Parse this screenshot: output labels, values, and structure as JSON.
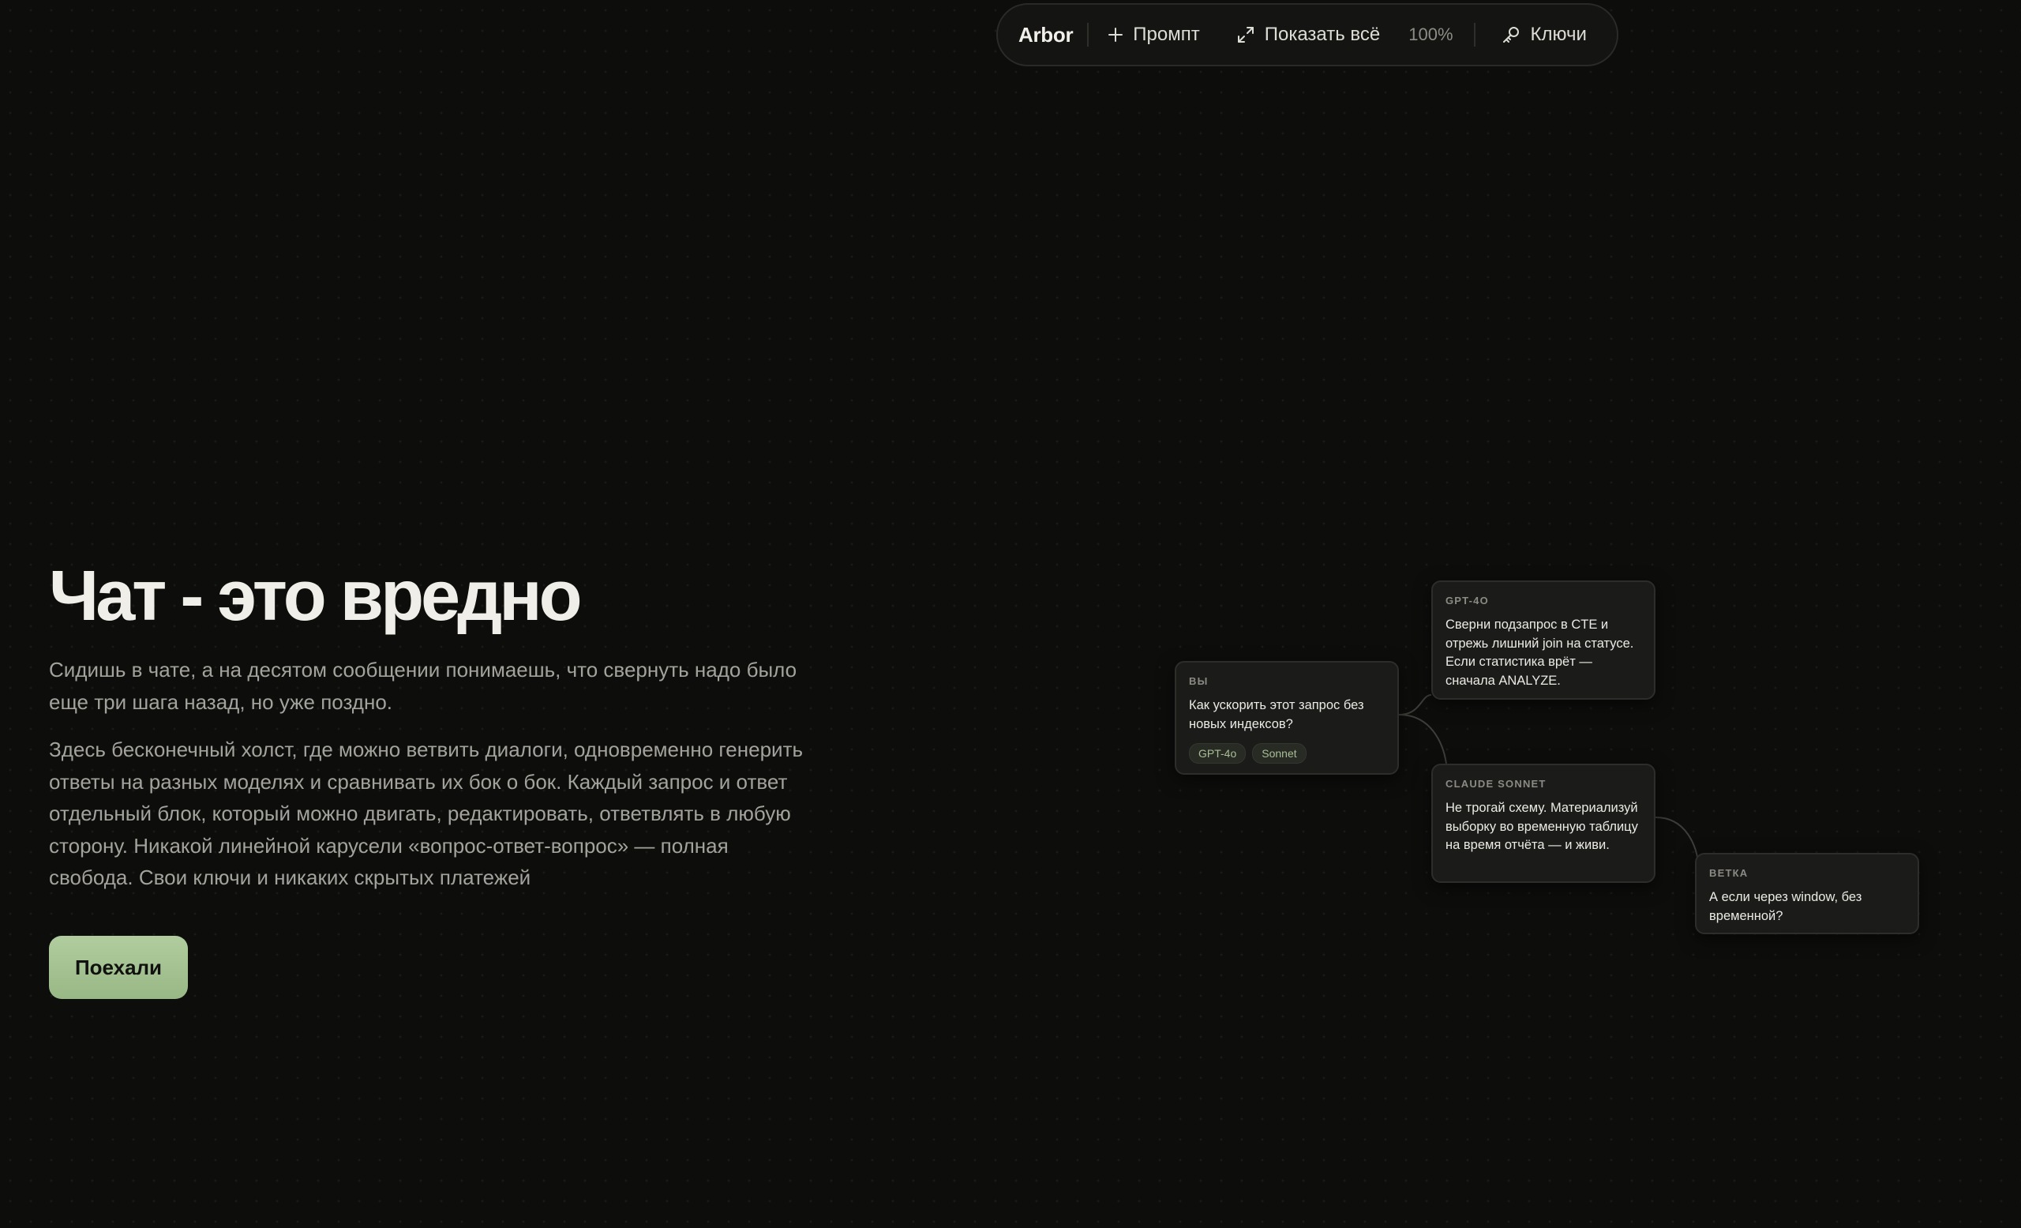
{
  "toolbar": {
    "brand": "Arbor",
    "prompt_label": "Промпт",
    "show_all_label": "Показать всё",
    "zoom": "100%",
    "keys_label": "Ключи"
  },
  "hero": {
    "title": "Чат - это вредно",
    "paragraph1": "Сидишь в чате, а на десятом сообщении понимаешь, что свернуть надо было еще три шага назад, но уже поздно.",
    "paragraph2": "Здесь бесконечный холст, где можно ветвить диалоги, одновременно генерить ответы на разных моделях и сравнивать их бок о бок. Каждый запрос и ответ отдельный блок, который можно двигать, редактировать, ответвлять в любую сторону. Никакой линейной карусели «вопрос-ответ-вопрос» — полная свобода. Свои ключи и никаких скрытых платежей",
    "cta_label": "Поехали"
  },
  "canvas": {
    "nodes": [
      {
        "label": "ВЫ",
        "text": "Как ускорить этот запрос без новых индексов?",
        "chips": [
          "GPT-4o",
          "Sonnet"
        ]
      },
      {
        "label": "GPT-4O",
        "text": "Сверни подзапрос в CTE и отрежь лишний join на статусе. Если статистика врёт — сначала ANALYZE."
      },
      {
        "label": "CLAUDE SONNET",
        "text": "Не трогай схему. Материализуй выборку во временную таблицу на время отчёта — и живи."
      },
      {
        "label": "ВЕТКА",
        "text": "А если через window, без временной?"
      }
    ]
  },
  "colors": {
    "background": "#0d0d0c",
    "accent": "#a8c596",
    "chip_text": "#a9be97"
  }
}
